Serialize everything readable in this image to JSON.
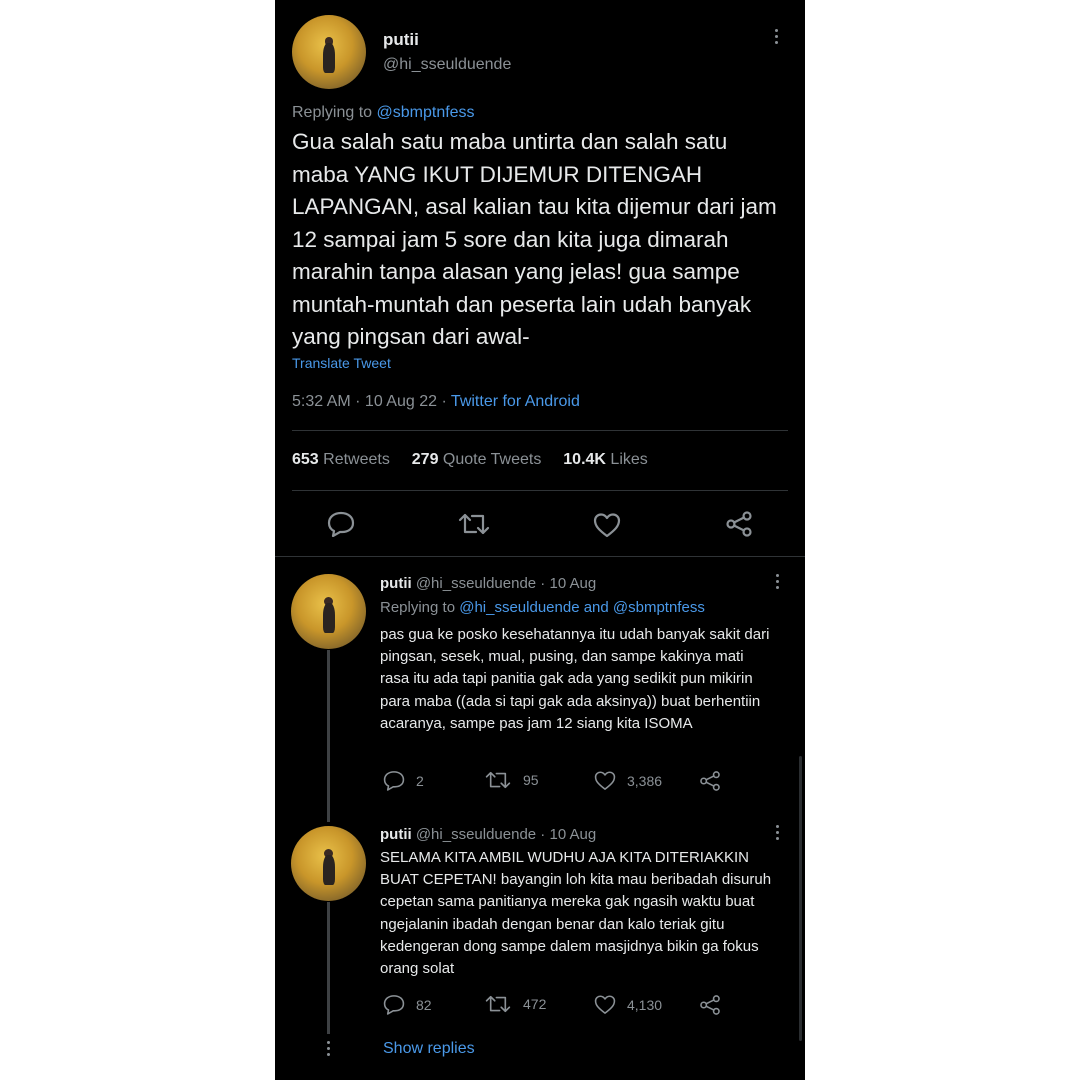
{
  "main_tweet": {
    "display_name": "putii",
    "handle": "@hi_sseulduende",
    "replying_prefix": "Replying to",
    "replying_to": "@sbmptnfess",
    "text": "Gua salah satu maba untirta dan salah satu maba YANG IKUT DIJEMUR DITENGAH LAPANGAN, asal kalian tau kita dijemur dari jam 12 sampai jam 5 sore dan kita juga dimarah marahin tanpa alasan yang jelas! gua sampe muntah-muntah dan peserta lain udah banyak yang pingsan dari awal-",
    "translate": "Translate Tweet",
    "time_date": "5:32 AM · 10 Aug 22 · ",
    "source": "Twitter for Android",
    "retweets_count": "653",
    "retweets_label": "Retweets",
    "quotes_count": "279",
    "quotes_label": "Quote Tweets",
    "likes_count": "10.4K",
    "likes_label": "Likes"
  },
  "replies": [
    {
      "display_name": "putii",
      "meta": "@hi_sseulduende · 10 Aug",
      "replying_prefix": "Replying to",
      "replying_to": "@hi_sseulduende and @sbmptnfess",
      "text": "pas gua ke posko kesehatannya itu udah banyak sakit dari pingsan, sesek, mual, pusing, dan sampe kakinya mati rasa itu ada tapi panitia gak ada yang sedikit pun mikirin para maba ((ada si tapi gak ada aksinya)) buat berhentiin acaranya, sampe pas jam 12 siang kita ISOMA",
      "replies": "2",
      "retweets": "95",
      "likes": "3,386"
    },
    {
      "display_name": "putii",
      "meta": "@hi_sseulduende · 10 Aug",
      "text": "SELAMA KITA AMBIL WUDHU AJA KITA DITERIAKKIN BUAT CEPETAN! bayangin loh kita mau beribadah disuruh cepetan sama panitianya mereka gak ngasih waktu buat ngejalanin ibadah dengan benar dan kalo teriak gitu kedengeran dong sampe dalem masjidnya bikin ga fokus orang solat",
      "replies": "82",
      "retweets": "472",
      "likes": "4,130"
    }
  ],
  "show_replies": "Show replies",
  "colors": {
    "background": "#000000",
    "text": "#e7e9ea",
    "muted": "#8b9196",
    "link": "#4a99e9"
  }
}
